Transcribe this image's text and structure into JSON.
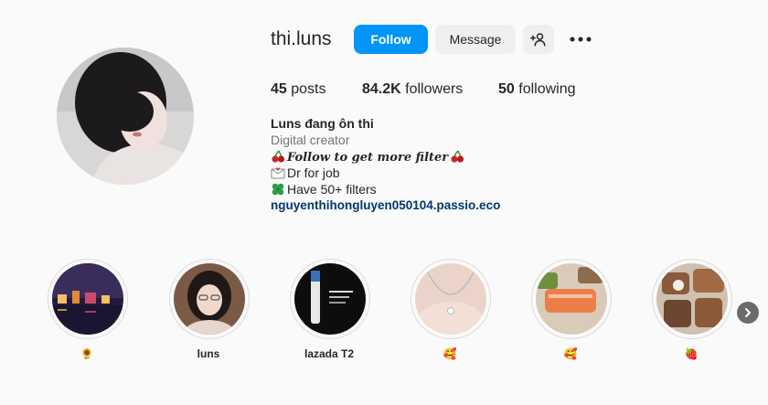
{
  "profile": {
    "username": "thi.luns",
    "follow_label": "Follow",
    "message_label": "Message",
    "stats": {
      "posts_count": "45",
      "posts_label": "posts",
      "followers_count": "84.2K",
      "followers_label": "followers",
      "following_count": "50",
      "following_label": "following"
    },
    "bio": {
      "name": "Luns đang ôn thi",
      "category": "Digital creator",
      "line1": "Follow to get more filter",
      "line2": "Dr for job",
      "line3": "Have 50+ filters",
      "link": "nguyenthihongluyen050104.passio.eco"
    }
  },
  "highlights": [
    {
      "label": "🌻"
    },
    {
      "label": "luns"
    },
    {
      "label": "lazada T2"
    },
    {
      "label": "🥰"
    },
    {
      "label": "🥰"
    },
    {
      "label": "🍓"
    }
  ],
  "icons": {
    "suggest": "add-person-icon",
    "more": "more-options-icon",
    "next": "chevron-right-icon"
  },
  "colors": {
    "accent": "#0095f6",
    "link": "#00376b",
    "secondary_text": "#737373"
  }
}
